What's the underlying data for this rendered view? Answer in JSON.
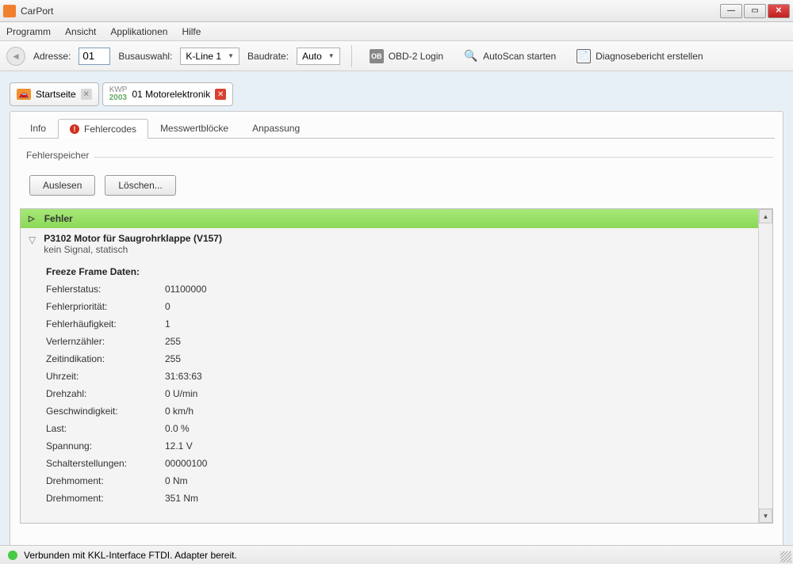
{
  "window": {
    "title": "CarPort"
  },
  "menu": {
    "programm": "Programm",
    "ansicht": "Ansicht",
    "applikationen": "Applikationen",
    "hilfe": "Hilfe"
  },
  "toolbar": {
    "adresse_label": "Adresse:",
    "adresse_value": "01",
    "busauswahl_label": "Busauswahl:",
    "busauswahl_value": "K-Line 1",
    "baudrate_label": "Baudrate:",
    "baudrate_value": "Auto",
    "obd2": "OBD-2 Login",
    "autoscan": "AutoScan starten",
    "report": "Diagnosebericht erstellen"
  },
  "doctabs": {
    "start": "Startseite",
    "kwp1": "KWP",
    "kwp2": "2003",
    "module": "01 Motorelektronik"
  },
  "subtabs": {
    "info": "Info",
    "fehlercodes": "Fehlercodes",
    "messwert": "Messwertblöcke",
    "anpassung": "Anpassung"
  },
  "fieldset": {
    "label": "Fehlerspeicher",
    "auslesen": "Auslesen",
    "loeschen": "Löschen..."
  },
  "error": {
    "header": "Fehler",
    "title": "P3102 Motor für Saugrohrklappe (V157)",
    "sub": "kein Signal, statisch",
    "ffhead": "Freeze Frame Daten:",
    "rows": [
      {
        "k": "Fehlerstatus:",
        "v": "01100000"
      },
      {
        "k": "Fehlerpriorität:",
        "v": "0"
      },
      {
        "k": "Fehlerhäufigkeit:",
        "v": "1"
      },
      {
        "k": "Verlernzähler:",
        "v": "255"
      },
      {
        "k": "Zeitindikation:",
        "v": "255"
      },
      {
        "k": "Uhrzeit:",
        "v": "31:63:63"
      },
      {
        "k": "Drehzahl:",
        "v": "0 U/min"
      },
      {
        "k": "Geschwindigkeit:",
        "v": "0 km/h"
      },
      {
        "k": "Last:",
        "v": "0.0 %"
      },
      {
        "k": "Spannung:",
        "v": "12.1 V"
      },
      {
        "k": "Schalterstellungen:",
        "v": "00000100"
      },
      {
        "k": "Drehmoment:",
        "v": "0 Nm"
      },
      {
        "k": "Drehmoment:",
        "v": "351 Nm"
      }
    ]
  },
  "status": {
    "text": "Verbunden mit KKL-Interface FTDI. Adapter bereit."
  }
}
